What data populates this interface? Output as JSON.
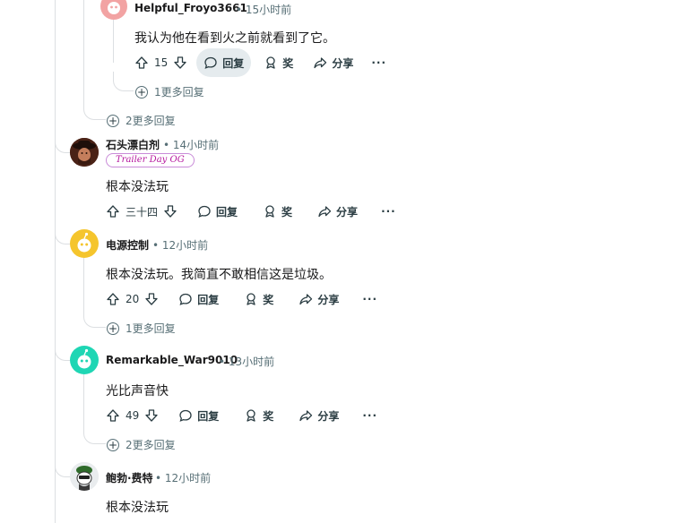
{
  "comments": [
    {
      "author": "Helpful_Froyo3661",
      "time": "15小时前",
      "text": "我认为他在看到火之前就看到了它。",
      "votes": "15",
      "reply": "回复",
      "award": "奖",
      "share": "分享",
      "more_replies": "1更多回复",
      "avatar_color": "#f2a3a3"
    },
    {
      "author": "石头漂白剂",
      "time": "14小时前",
      "flair": "Trailer Day OG",
      "text": "根本没法玩",
      "votes": "三十四",
      "reply": "回复",
      "award": "奖",
      "share": "分享"
    },
    {
      "author": "电源控制",
      "time": "12小时前",
      "text": "根本没法玩。我简直不敢相信这是垃圾。",
      "votes": "20",
      "reply": "回复",
      "award": "奖",
      "share": "分享",
      "more_replies": "1更多回复",
      "avatar_color": "#f5c52d"
    },
    {
      "author": "Remarkable_War9010",
      "time": "13小时前",
      "text": "光比声音快",
      "votes": "49",
      "reply": "回复",
      "award": "奖",
      "share": "分享",
      "more_replies": "2更多回复",
      "avatar_color": "#1fd6b4"
    },
    {
      "author": "鲍勃·费特",
      "time": "12小时前",
      "text": "根本没法玩"
    }
  ],
  "thread_more_replies": "2更多回复",
  "separator": "•",
  "overflow_icon": "···"
}
